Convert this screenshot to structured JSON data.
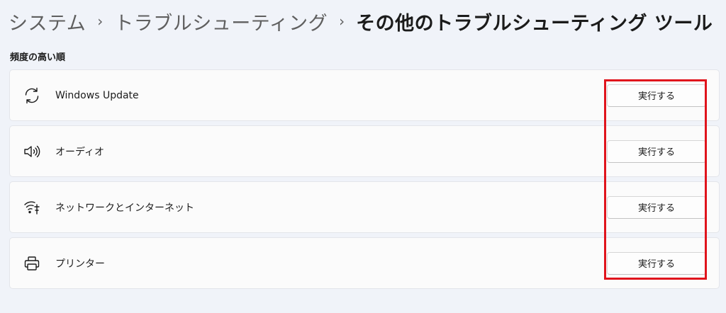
{
  "breadcrumb": {
    "items": [
      "システム",
      "トラブルシューティング"
    ],
    "separator": "›",
    "current": "その他のトラブルシューティング ツール"
  },
  "section": {
    "title": "頻度の高い順"
  },
  "troubleshooters": [
    {
      "label": "Windows Update",
      "icon": "sync-icon",
      "button": "実行する"
    },
    {
      "label": "オーディオ",
      "icon": "speaker-icon",
      "button": "実行する"
    },
    {
      "label": "ネットワークとインターネット",
      "icon": "network-icon",
      "button": "実行する"
    },
    {
      "label": "プリンター",
      "icon": "printer-icon",
      "button": "実行する"
    }
  ],
  "annotation": {
    "highlight_color": "#e0141c"
  }
}
